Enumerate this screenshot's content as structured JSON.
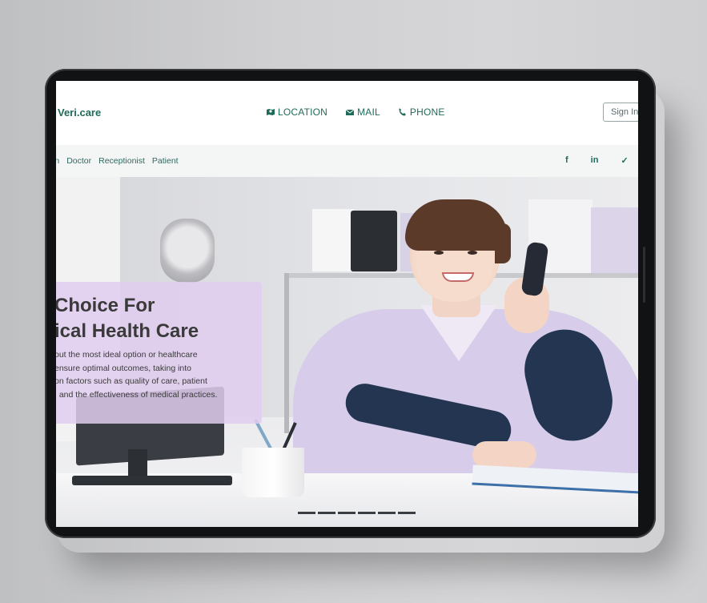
{
  "header": {
    "logo": "Veri.care",
    "contacts": [
      {
        "label": "LOCATION",
        "icon": "map-pin-icon"
      },
      {
        "label": "MAIL",
        "icon": "mail-icon"
      },
      {
        "label": "PHONE",
        "icon": "phone-icon"
      }
    ],
    "signin_label": "Sign In"
  },
  "nav": {
    "items": [
      "in",
      "Doctor",
      "Receptionist",
      "Patient"
    ],
    "socials": [
      "f",
      "in",
      "✓"
    ]
  },
  "hero": {
    "title_line1": "Choice For",
    "title_line2": "ical Health Care",
    "description": [
      "out the most ideal option or healthcare",
      "ensure optimal outcomes, taking into",
      "on factors such as quality of care, patient",
      ", and the effectiveness of medical practices."
    ],
    "slides_count": 6
  },
  "colors": {
    "brand": "#1f6b5a",
    "caption_bg": "#e1cdee"
  }
}
